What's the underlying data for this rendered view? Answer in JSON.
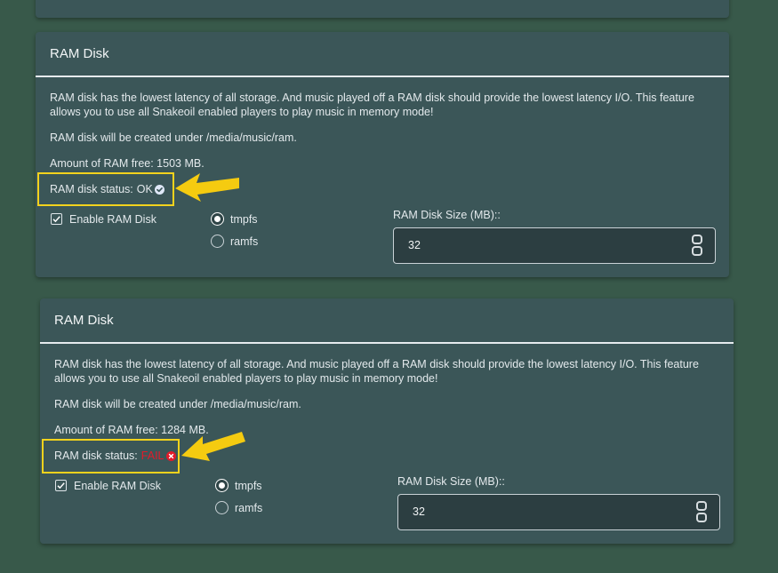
{
  "cards": [
    {
      "title": "RAM Disk",
      "description": "RAM disk has the lowest latency of all storage. And music played off a RAM disk should provide the lowest latency I/O. This feature allows you to use all Snakeoil enabled players to play music in memory mode!",
      "location": "RAM disk will be created under /media/music/ram.",
      "ram_free": "Amount of RAM free: 1503 MB.",
      "status_label": "RAM disk status:",
      "status_value": "OK",
      "status_kind": "ok",
      "enable_label": "Enable RAM Disk",
      "enable_checked": true,
      "fs_options": [
        "tmpfs",
        "ramfs"
      ],
      "fs_selected": "tmpfs",
      "size_label": "RAM Disk Size (MB)::",
      "size_value": "32"
    },
    {
      "title": "RAM Disk",
      "description": "RAM disk has the lowest latency of all storage. And music played off a RAM disk should provide the lowest latency I/O. This feature allows you to use all Snakeoil enabled players to play music in memory mode!",
      "location": "RAM disk will be created under /media/music/ram.",
      "ram_free": "Amount of RAM free: 1284 MB.",
      "status_label": "RAM disk status:",
      "status_value": "FAIL",
      "status_kind": "fail",
      "enable_label": "Enable RAM Disk",
      "enable_checked": true,
      "fs_options": [
        "tmpfs",
        "ramfs"
      ],
      "fs_selected": "tmpfs",
      "size_label": "RAM Disk Size (MB)::",
      "size_value": "32"
    }
  ],
  "icons": {
    "ok": "check-circle-icon",
    "fail": "x-circle-icon",
    "annotation": "arrow-icon",
    "checkbox": "checkmark-icon"
  },
  "colors": {
    "page_background": "#38594a",
    "card_background": "#3b5658",
    "highlight_box": "#f2d21d",
    "annotation_arrow": "#f5cb10",
    "fail_text": "#e21b2a",
    "input_background": "#2c3e41"
  }
}
